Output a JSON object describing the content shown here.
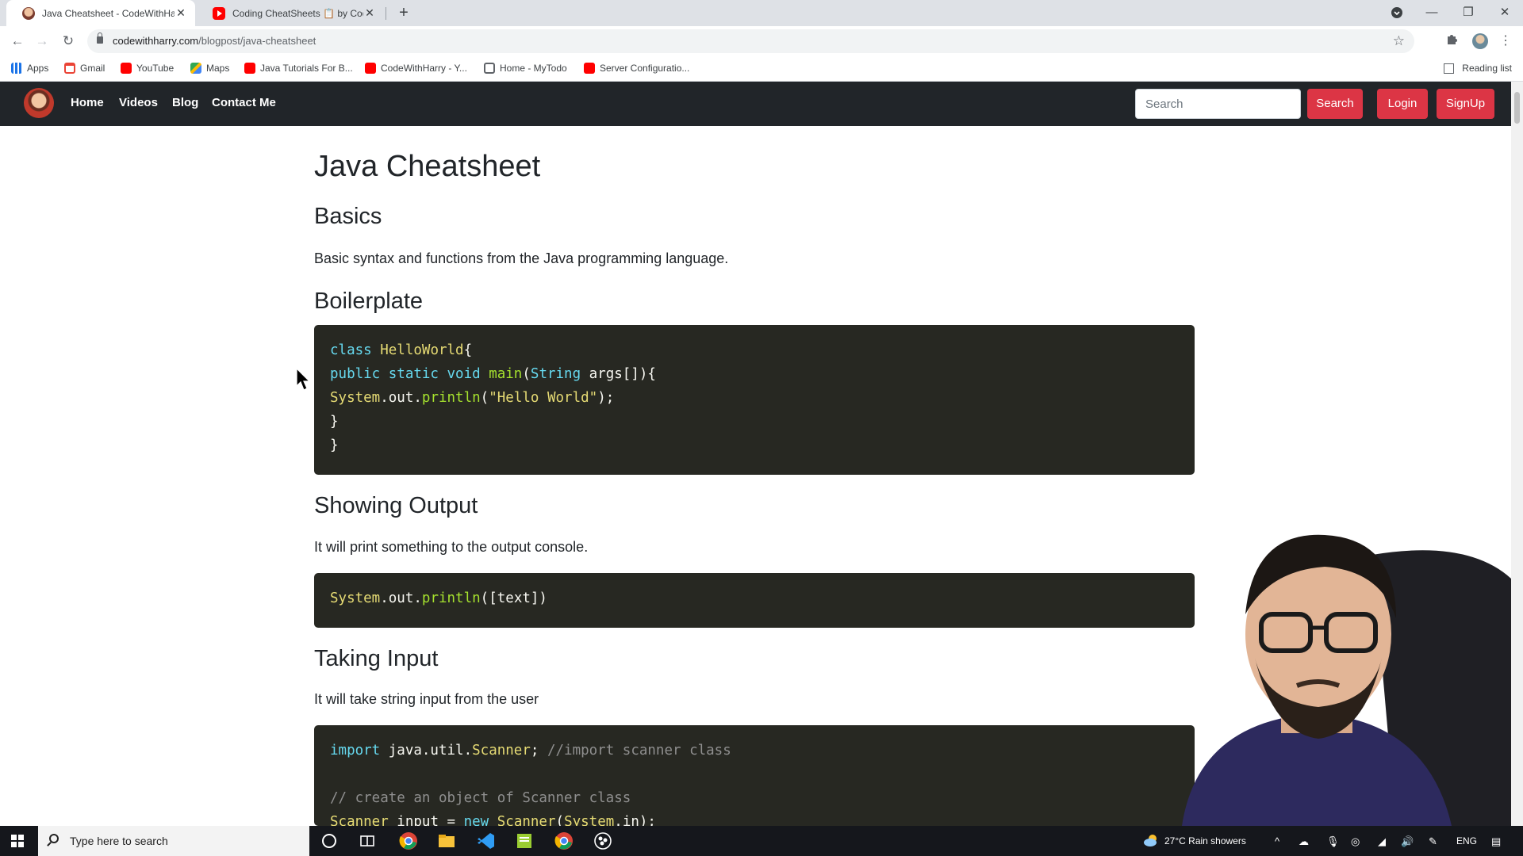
{
  "browser": {
    "tabs": [
      {
        "title": "Java Cheatsheet - CodeWithHarry",
        "active": true
      },
      {
        "title": "Coding CheatSheets 📋 by CodeWithHarry",
        "active": false
      }
    ],
    "url_host": "codewithharry.com",
    "url_path": "/blogpost/java-cheatsheet",
    "bookmarks": [
      {
        "label": "Apps",
        "icon": "apps-grid-icon"
      },
      {
        "label": "Gmail",
        "icon": "gmail-icon"
      },
      {
        "label": "YouTube",
        "icon": "youtube-icon"
      },
      {
        "label": "Maps",
        "icon": "maps-icon"
      },
      {
        "label": "Java Tutorials For B...",
        "icon": "youtube-icon"
      },
      {
        "label": "CodeWithHarry - Y...",
        "icon": "youtube-icon"
      },
      {
        "label": "Home - MyTodo",
        "icon": "globe-icon"
      },
      {
        "label": "Server Configuratio...",
        "icon": "youtube-icon"
      }
    ],
    "reading_list": "Reading list"
  },
  "site": {
    "nav": [
      "Home",
      "Videos",
      "Blog",
      "Contact Me"
    ],
    "search_placeholder": "Search",
    "search_button": "Search",
    "login_button": "Login",
    "signup_button": "SignUp"
  },
  "article": {
    "title": "Java Cheatsheet",
    "sections": [
      {
        "heading": "Basics",
        "text": "Basic syntax and functions from the Java programming language."
      },
      {
        "heading": "Boilerplate",
        "code": [
          "class HelloWorld{",
          "public static void main(String args[]){",
          "System.out.println(\"Hello World\");",
          "}",
          "}"
        ]
      },
      {
        "heading": "Showing Output",
        "text": "It will print something to the output console.",
        "code": [
          "System.out.println([text])"
        ]
      },
      {
        "heading": "Taking Input",
        "text": "It will take string input from the user",
        "code": [
          "import java.util.Scanner; //import scanner class",
          "",
          "// create an object of Scanner class",
          "Scanner input = new Scanner(System.in);"
        ]
      }
    ]
  },
  "taskbar": {
    "search_placeholder": "Type here to search",
    "weather": "27°C  Rain showers",
    "language": "ENG"
  },
  "colors": {
    "navbar_bg": "#212529",
    "accent_red": "#dc3545",
    "code_bg": "#272822"
  }
}
